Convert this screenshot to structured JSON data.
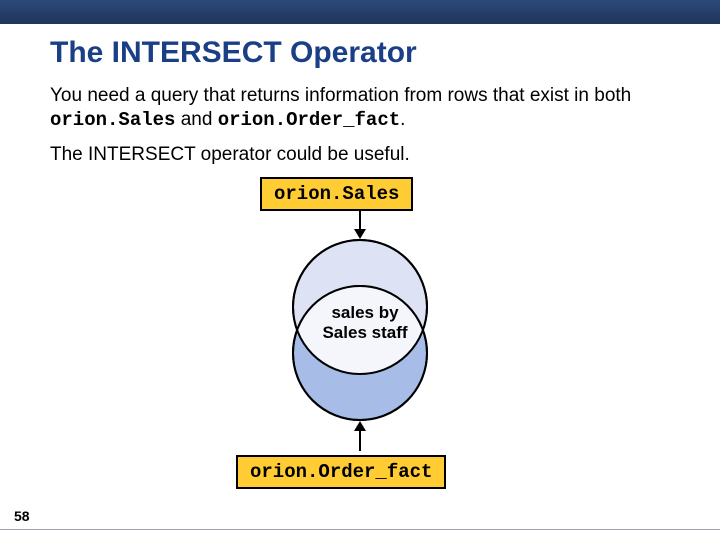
{
  "header": {
    "title": "The INTERSECT Operator"
  },
  "body": {
    "p1_a": "You need a query that returns information from rows that exist in both ",
    "p1_code1": "orion.Sales",
    "p1_b": " and ",
    "p1_code2": "orion.Order_fact",
    "p1_c": ".",
    "p2": "The INTERSECT operator could be useful."
  },
  "diagram": {
    "top_label": "orion.Sales",
    "bottom_label": "orion.Order_fact",
    "intersect_label_line1": "sales by",
    "intersect_label_line2": "Sales staff"
  },
  "page_number": "58"
}
